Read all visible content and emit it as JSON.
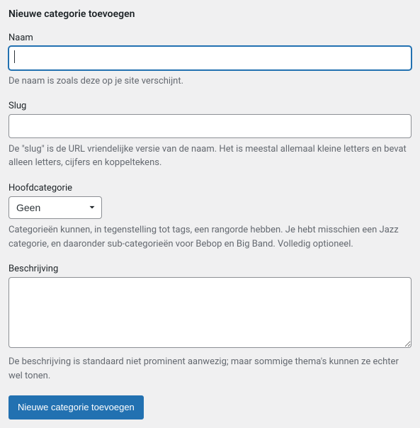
{
  "form": {
    "title": "Nieuwe categorie toevoegen",
    "fields": {
      "name": {
        "label": "Naam",
        "value": "",
        "help": "De naam is zoals deze op je site verschijnt."
      },
      "slug": {
        "label": "Slug",
        "value": "",
        "help": "De \"slug\" is de URL vriendelijke versie van de naam. Het is meestal allemaal kleine letters en bevat alleen letters, cijfers en koppeltekens."
      },
      "parent": {
        "label": "Hoofdcategorie",
        "selected": "Geen",
        "help": "Categorieën kunnen, in tegenstelling tot tags, een rangorde hebben. Je hebt misschien een Jazz categorie, en daaronder sub-categorieën voor Bebop en Big Band. Volledig optioneel."
      },
      "description": {
        "label": "Beschrijving",
        "value": "",
        "help": "De beschrijving is standaard niet prominent aanwezig; maar sommige thema's kunnen ze echter wel tonen."
      }
    },
    "submit_label": "Nieuwe categorie toevoegen"
  }
}
